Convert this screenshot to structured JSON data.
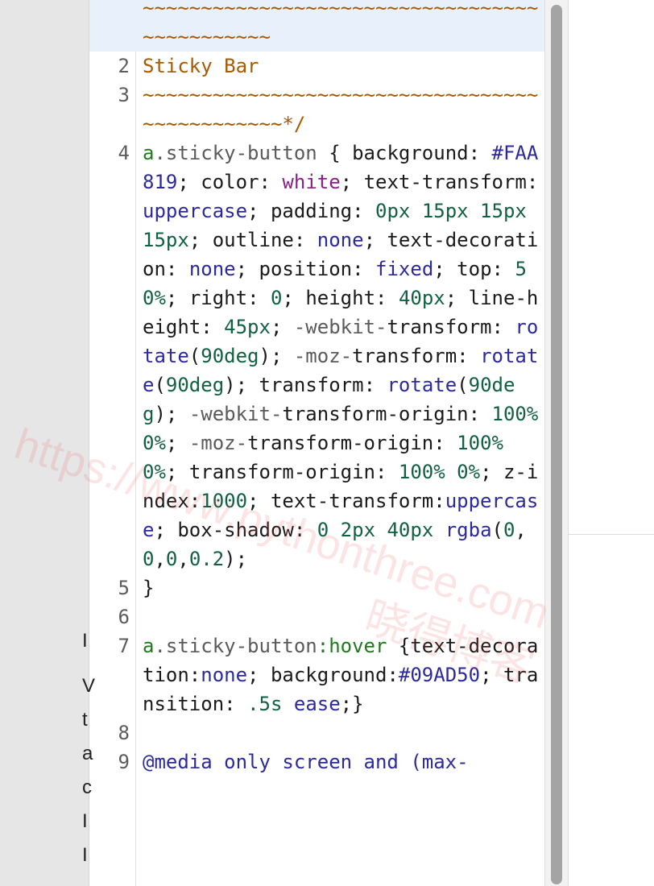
{
  "code_lines": [
    {
      "num": "",
      "active": true,
      "tokens": [
        {
          "t": "~~~~~~~~~~~~~~~~~~~~~~~~~~~~~~~~~~~~~~~~~~~~~",
          "c": "cm"
        }
      ]
    },
    {
      "num": "2",
      "tokens": [
        {
          "t": "Sticky Bar",
          "c": "cm"
        }
      ]
    },
    {
      "num": "3",
      "tokens": [
        {
          "t": "~~~~~~~~~~~~~~~~~~~~~~~~~~~~~~~~~~~~~~~~~~~~~~*/",
          "c": "cm"
        }
      ]
    },
    {
      "num": "4",
      "tokens": [
        {
          "t": "a",
          "c": "tg"
        },
        {
          "t": ".sticky-button",
          "c": "df"
        },
        {
          "t": " { ",
          "c": "pr"
        },
        {
          "t": "background",
          "c": "pr"
        },
        {
          "t": ": ",
          "c": "pr"
        },
        {
          "t": "#FAA819",
          "c": "kw"
        },
        {
          "t": "; ",
          "c": "pr"
        },
        {
          "t": "color",
          "c": "pr"
        },
        {
          "t": ": ",
          "c": "pr"
        },
        {
          "t": "white",
          "c": "at"
        },
        {
          "t": "; ",
          "c": "pr"
        },
        {
          "t": "text-transform",
          "c": "pr"
        },
        {
          "t": ": ",
          "c": "pr"
        },
        {
          "t": "uppercase",
          "c": "kw"
        },
        {
          "t": "; ",
          "c": "pr"
        },
        {
          "t": "padding",
          "c": "pr"
        },
        {
          "t": ": ",
          "c": "pr"
        },
        {
          "t": "0px 15px 15px 15px",
          "c": "nm"
        },
        {
          "t": "; ",
          "c": "pr"
        },
        {
          "t": "outline",
          "c": "pr"
        },
        {
          "t": ": ",
          "c": "pr"
        },
        {
          "t": "none",
          "c": "kw"
        },
        {
          "t": "; ",
          "c": "pr"
        },
        {
          "t": "text-decoration",
          "c": "pr"
        },
        {
          "t": ": ",
          "c": "pr"
        },
        {
          "t": "none",
          "c": "kw"
        },
        {
          "t": "; ",
          "c": "pr"
        },
        {
          "t": "position",
          "c": "pr"
        },
        {
          "t": ": ",
          "c": "pr"
        },
        {
          "t": "fixed",
          "c": "kw"
        },
        {
          "t": "; ",
          "c": "pr"
        },
        {
          "t": "top",
          "c": "pr"
        },
        {
          "t": ": ",
          "c": "pr"
        },
        {
          "t": "50%",
          "c": "nm"
        },
        {
          "t": "; ",
          "c": "pr"
        },
        {
          "t": "right",
          "c": "pr"
        },
        {
          "t": ": ",
          "c": "pr"
        },
        {
          "t": "0",
          "c": "nm"
        },
        {
          "t": "; ",
          "c": "pr"
        },
        {
          "t": "height",
          "c": "pr"
        },
        {
          "t": ": ",
          "c": "pr"
        },
        {
          "t": "40px",
          "c": "nm"
        },
        {
          "t": "; ",
          "c": "pr"
        },
        {
          "t": "line-height",
          "c": "pr"
        },
        {
          "t": ": ",
          "c": "pr"
        },
        {
          "t": "45px",
          "c": "nm"
        },
        {
          "t": "; ",
          "c": "pr"
        },
        {
          "t": "-webkit-",
          "c": "df"
        },
        {
          "t": "transform",
          "c": "pr"
        },
        {
          "t": ": ",
          "c": "pr"
        },
        {
          "t": "rotate",
          "c": "kw"
        },
        {
          "t": "(",
          "c": "pr"
        },
        {
          "t": "90deg",
          "c": "nm"
        },
        {
          "t": "); ",
          "c": "pr"
        },
        {
          "t": "-moz-",
          "c": "df"
        },
        {
          "t": "transform",
          "c": "pr"
        },
        {
          "t": ": ",
          "c": "pr"
        },
        {
          "t": "rotate",
          "c": "kw"
        },
        {
          "t": "(",
          "c": "pr"
        },
        {
          "t": "90deg",
          "c": "nm"
        },
        {
          "t": "); ",
          "c": "pr"
        },
        {
          "t": "transform",
          "c": "pr"
        },
        {
          "t": ": ",
          "c": "pr"
        },
        {
          "t": "rotate",
          "c": "kw"
        },
        {
          "t": "(",
          "c": "pr"
        },
        {
          "t": "90deg",
          "c": "nm"
        },
        {
          "t": "); ",
          "c": "pr"
        },
        {
          "t": "-webkit-",
          "c": "df"
        },
        {
          "t": "transform-origin",
          "c": "pr"
        },
        {
          "t": ": ",
          "c": "pr"
        },
        {
          "t": "100% 0%",
          "c": "nm"
        },
        {
          "t": "; ",
          "c": "pr"
        },
        {
          "t": "-moz-",
          "c": "df"
        },
        {
          "t": "transform-origin",
          "c": "pr"
        },
        {
          "t": ": ",
          "c": "pr"
        },
        {
          "t": "100% 0%",
          "c": "nm"
        },
        {
          "t": "; ",
          "c": "pr"
        },
        {
          "t": "transform-origin",
          "c": "pr"
        },
        {
          "t": ": ",
          "c": "pr"
        },
        {
          "t": "100% 0%",
          "c": "nm"
        },
        {
          "t": "; ",
          "c": "pr"
        },
        {
          "t": "z-index",
          "c": "pr"
        },
        {
          "t": ":",
          "c": "pr"
        },
        {
          "t": "1000",
          "c": "nm"
        },
        {
          "t": "; ",
          "c": "pr"
        },
        {
          "t": "text-transform",
          "c": "pr"
        },
        {
          "t": ":",
          "c": "pr"
        },
        {
          "t": "uppercase",
          "c": "kw"
        },
        {
          "t": "; ",
          "c": "pr"
        },
        {
          "t": "box-shadow",
          "c": "pr"
        },
        {
          "t": ": ",
          "c": "pr"
        },
        {
          "t": "0 2px 40px ",
          "c": "nm"
        },
        {
          "t": "rgba",
          "c": "kw"
        },
        {
          "t": "(",
          "c": "pr"
        },
        {
          "t": "0",
          "c": "nm"
        },
        {
          "t": ",",
          "c": "pr"
        },
        {
          "t": "0",
          "c": "nm"
        },
        {
          "t": ",",
          "c": "pr"
        },
        {
          "t": "0",
          "c": "nm"
        },
        {
          "t": ",",
          "c": "pr"
        },
        {
          "t": "0.2",
          "c": "nm"
        },
        {
          "t": ");",
          "c": "pr"
        }
      ]
    },
    {
      "num": "5",
      "tokens": [
        {
          "t": "}",
          "c": "pr"
        }
      ]
    },
    {
      "num": "6",
      "tokens": [
        {
          "t": "",
          "c": "pr"
        }
      ]
    },
    {
      "num": "7",
      "tokens": [
        {
          "t": "a",
          "c": "tg"
        },
        {
          "t": ".sticky-button",
          "c": "df"
        },
        {
          "t": ":hover",
          "c": "tg"
        },
        {
          "t": " {",
          "c": "pr"
        },
        {
          "t": "text-decoration",
          "c": "pr"
        },
        {
          "t": ":",
          "c": "pr"
        },
        {
          "t": "none",
          "c": "kw"
        },
        {
          "t": "; ",
          "c": "pr"
        },
        {
          "t": "background",
          "c": "pr"
        },
        {
          "t": ":",
          "c": "pr"
        },
        {
          "t": "#09AD50",
          "c": "kw"
        },
        {
          "t": "; ",
          "c": "pr"
        },
        {
          "t": "transition",
          "c": "pr"
        },
        {
          "t": ": ",
          "c": "pr"
        },
        {
          "t": ".5s",
          "c": "nm"
        },
        {
          "t": " ",
          "c": "pr"
        },
        {
          "t": "ease",
          "c": "kw"
        },
        {
          "t": ";}",
          "c": "pr"
        }
      ]
    },
    {
      "num": "8",
      "tokens": [
        {
          "t": "",
          "c": "pr"
        }
      ]
    },
    {
      "num": "9",
      "tokens": [
        {
          "t": "@media only screen and (max-",
          "c": "kw"
        }
      ]
    }
  ],
  "right_panel_letters": [
    "I",
    "V",
    "t",
    "a",
    "c",
    "I",
    "I"
  ],
  "watermark": {
    "url": "https://www.pythonthree.com",
    "cn": "晓得博客"
  }
}
